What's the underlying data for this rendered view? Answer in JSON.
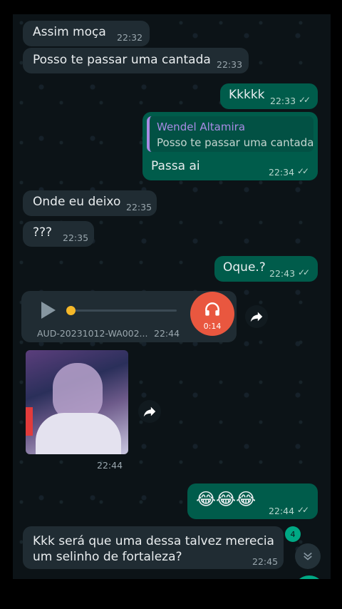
{
  "messages": [
    {
      "text": "Assim moça",
      "time": "22:32"
    },
    {
      "text": "Posso te passar uma cantada",
      "time": "22:33"
    },
    {
      "text": "Kkkkk",
      "time": "22:33",
      "ticks": "✓✓"
    },
    {
      "reply_name": "Wendel Altamira",
      "reply_text": "Posso te passar uma cantada",
      "text": "Passa ai",
      "time": "22:34",
      "ticks": "✓✓"
    },
    {
      "text": "Onde eu deixo",
      "time": "22:35"
    },
    {
      "text": "???",
      "time": "22:35"
    },
    {
      "text": "Oque.?",
      "time": "22:43",
      "ticks": "✓✓"
    },
    {
      "text": "😂😂😂",
      "time": "22:44",
      "ticks": "✓✓"
    },
    {
      "text": "Kkk será que uma dessa talvez merecia",
      "text2": "um selinho de fortaleza?",
      "time": "22:45"
    }
  ],
  "audio": {
    "filename": "AUD-20231012-WA002...",
    "time": "22:44",
    "duration": "0:14",
    "progress": 0
  },
  "photo": {
    "time": "22:44"
  },
  "unread_badge": "4",
  "colors": {
    "incoming": "#202c33",
    "outgoing": "#005c4b",
    "background": "#0c1317",
    "reply_name": "#a88be4",
    "audio_button": "#e9573f"
  }
}
